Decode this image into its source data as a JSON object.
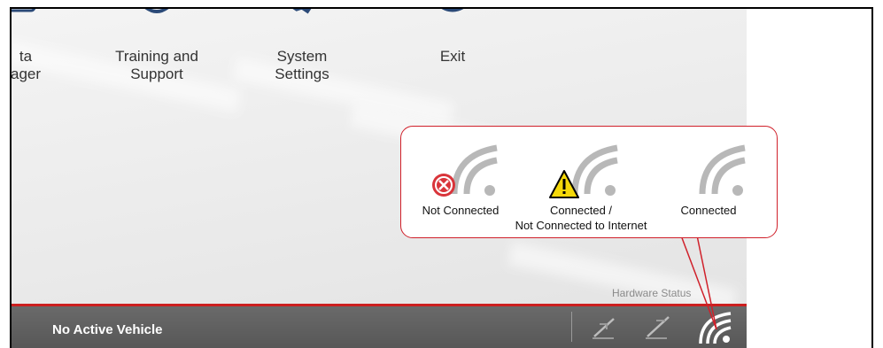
{
  "menu": [
    {
      "id": "data-manager",
      "label": "ta\nager"
    },
    {
      "id": "training",
      "label": "Training and\nSupport"
    },
    {
      "id": "settings",
      "label": "System\nSettings"
    },
    {
      "id": "exit",
      "label": "Exit"
    }
  ],
  "hardware_status": {
    "label": "Hardware Status",
    "legend": [
      {
        "label": "Not Connected",
        "badge": "error-x-icon",
        "color": "#d9343a"
      },
      {
        "label": "Connected /\nNot Connected to Internet",
        "badge": "warning-triangle-icon",
        "color": "#f5d90a"
      },
      {
        "label": "Connected",
        "badge": "none"
      }
    ]
  },
  "statusbar": {
    "vehicle": "No Active Vehicle"
  },
  "colors": {
    "accent": "#cc1f1f",
    "statusbar": "#5f5f5f",
    "callout_border": "#d0202a"
  }
}
